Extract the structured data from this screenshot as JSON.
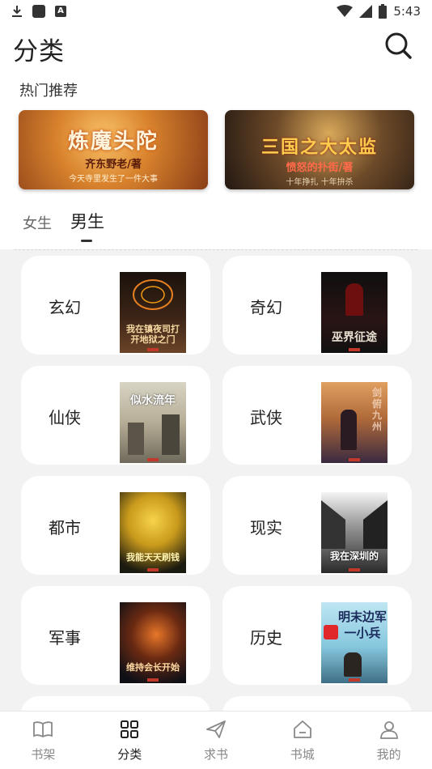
{
  "status_bar": {
    "time": "5:43"
  },
  "header": {
    "title": "分类"
  },
  "hot": {
    "title": "热门推荐",
    "banners": [
      {
        "title": "炼魔头陀",
        "author": "齐东野老/著",
        "tagline": "今天寺里发生了一件大事"
      },
      {
        "title": "三国之大太监",
        "author": "愤怒的扑街/著",
        "tagline": "十年挣扎 十年拚杀"
      }
    ]
  },
  "gender_tabs": {
    "female": "女生",
    "male": "男生"
  },
  "categories": [
    {
      "label": "玄幻",
      "cover_text": "我在镇夜司打开地狱之门"
    },
    {
      "label": "奇幻",
      "cover_text": "巫界征途"
    },
    {
      "label": "仙侠",
      "cover_text": "似水流年"
    },
    {
      "label": "武侠",
      "cover_text": "剑俯九州"
    },
    {
      "label": "都市",
      "cover_text": "我能天天刷钱"
    },
    {
      "label": "现实",
      "cover_text": "我在深圳的"
    },
    {
      "label": "军事",
      "cover_text": "维持会长开始"
    },
    {
      "label": "历史",
      "cover_text": "明末边军一小兵"
    }
  ],
  "bottom_nav": [
    {
      "label": "书架",
      "icon": "book-icon"
    },
    {
      "label": "分类",
      "icon": "grid-icon"
    },
    {
      "label": "求书",
      "icon": "paper-plane-icon"
    },
    {
      "label": "书城",
      "icon": "store-icon"
    },
    {
      "label": "我的",
      "icon": "user-icon"
    }
  ],
  "active_nav": "分类"
}
